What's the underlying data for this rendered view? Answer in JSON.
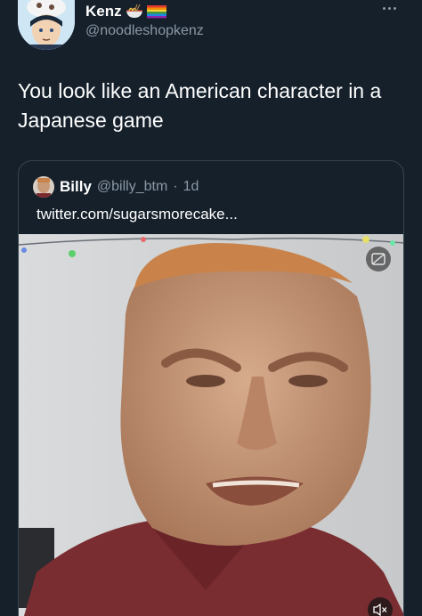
{
  "author": {
    "display_name": "Kenz",
    "handle": "@noodleshopkenz",
    "emojis": [
      "ramen-emoji",
      "rainbow-flag-emoji"
    ]
  },
  "tweet": {
    "text": "You look like an American character in a Japanese game"
  },
  "quote": {
    "display_name": "Billy",
    "handle": "@billy_btm",
    "separator": "·",
    "time": "1d",
    "text": "twitter.com/sugarsmorecake..."
  },
  "media": {
    "icons": [
      "gif-badge-icon",
      "speaker-muted-icon"
    ]
  },
  "colors": {
    "background": "#15202b",
    "secondary_text": "#8b98a5",
    "card_border": "#38444d"
  }
}
